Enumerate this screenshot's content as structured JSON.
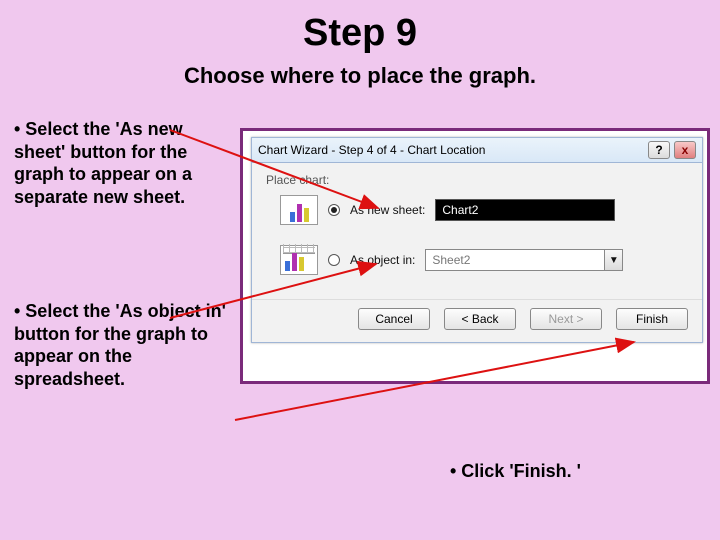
{
  "title": "Step 9",
  "subtitle": "Choose where to place the graph.",
  "instruction1": "• Select the 'As new sheet' button for the graph to appear on a separate new sheet.",
  "instruction2": "• Select the 'As object in' button for the graph to appear on the spreadsheet.",
  "footer_note": "• Click 'Finish. '",
  "dialog": {
    "title": "Chart Wizard - Step 4 of 4 - Chart Location",
    "section_label": "Place chart:",
    "option_new_sheet": {
      "label": "As new sheet:",
      "value": "Chart2"
    },
    "option_object_in": {
      "label": "As object in:",
      "value": "Sheet2"
    },
    "buttons": {
      "cancel": "Cancel",
      "back": "< Back",
      "next": "Next >",
      "finish": "Finish"
    }
  }
}
